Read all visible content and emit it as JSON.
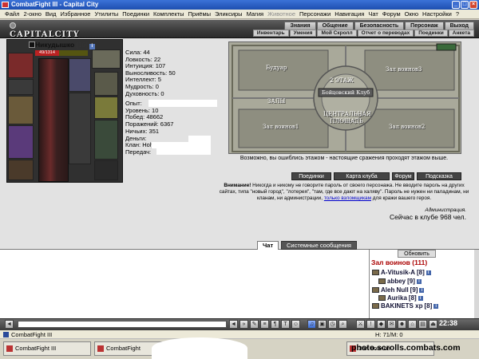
{
  "window": {
    "title": "CombatFight III - Capital City",
    "controls": [
      "_",
      "□",
      "×"
    ]
  },
  "menu": {
    "items": [
      "Файл",
      "2-окно",
      "Вид",
      "Избранное",
      "Утилиты",
      "Поединки",
      "Комплекты",
      "Приёмы",
      "Эликсиры",
      "Магия"
    ],
    "dim_item": "Животное",
    "items2": [
      "Персонажи",
      "Навигация",
      "Чат",
      "Форум",
      "Окно",
      "Настройки",
      "?"
    ]
  },
  "header": {
    "logo": "CAPITALCITY",
    "nav_top": [
      "Знания",
      "Общение",
      "Безопасность",
      "Персонаж",
      "Выход"
    ],
    "nav_sub": [
      "Инвентарь",
      "Умения",
      "Мой Скролл",
      "Отчет о переводах",
      "Поединки",
      "Анкета"
    ]
  },
  "character": {
    "name": "Никудышко",
    "level": "[10]",
    "badge": "i",
    "hp": "49/1314"
  },
  "stats": [
    {
      "label": "Сила: 44"
    },
    {
      "label": "Ловкость: 22"
    },
    {
      "label": "Интуиция: 107"
    },
    {
      "label": "Выносливость: 50"
    },
    {
      "label": "Интеллект: 5"
    },
    {
      "label": "Мудрость: 0"
    },
    {
      "label": "Духовность: 0"
    }
  ],
  "stats2": [
    {
      "label": "Опыт:"
    },
    {
      "label": "Уровень: 10"
    },
    {
      "label": "Побед: 48662"
    },
    {
      "label": "Поражений: 6367"
    },
    {
      "label": "Ничьих: 351"
    },
    {
      "label": "Деньги:"
    },
    {
      "label": "Клан: HolyKnighhts"
    },
    {
      "label": "Передач:"
    }
  ],
  "map": {
    "labels": {
      "boudoir": "Будуар",
      "floor": "2 ЭТАЖ",
      "hall3": "Зал воинов3",
      "reception": "Бойцовский Клуб",
      "halls": "ЗАЛЫ",
      "central": "ЦЕНТРАЛЬНАЯ ПЛОЩАДЬ",
      "hall1": "Зал воинов1",
      "hall2": "Зал воинов2"
    },
    "caption": "Возможно, вы ошиблись этажом - настоящие сражения проходят этажом выше."
  },
  "map_buttons": [
    "Поединки",
    "Карта клуба",
    "Форум",
    "Подсказка"
  ],
  "notice": {
    "bold": "Внимание!",
    "text": " Никогда и никому не говорите пароль от своего персонажа. Не вводите пароль на других сайтах, типа \"новый город\", \"лотерея\", \"там, где все дают на халяву\". Пароль не нужен ни паладинам, ни кланам, ни администрации, ",
    "link": "только взломщикам",
    "tail": " для кражи вашего героя.",
    "signature": "Администрация."
  },
  "online": "Сейчас в клубе 968 чел.",
  "chat": {
    "tabs": [
      "Чат",
      "Системные сообщения"
    ],
    "refresh": "Обновить",
    "room": "Зал воинов (111)",
    "players": [
      {
        "name": "A-Vitusik-A",
        "level": "[8]"
      },
      {
        "name": "abbey",
        "level": "[9]"
      },
      {
        "name": "Aleh Null",
        "level": "[9]"
      },
      {
        "name": "Aurika",
        "level": "[8]"
      },
      {
        "name": "BAKINETS xp",
        "level": "[8]"
      }
    ]
  },
  "toolbar": {
    "clock": "22:38"
  },
  "taskbar": {
    "row1": [
      "CombatFight III"
    ],
    "row1_right": "Н: 71/М: 0",
    "tasks": [
      "CombatFight III",
      "CombatFight",
      "Зал воинов"
    ]
  },
  "watermark": "photo.scrolls.combats.com"
}
